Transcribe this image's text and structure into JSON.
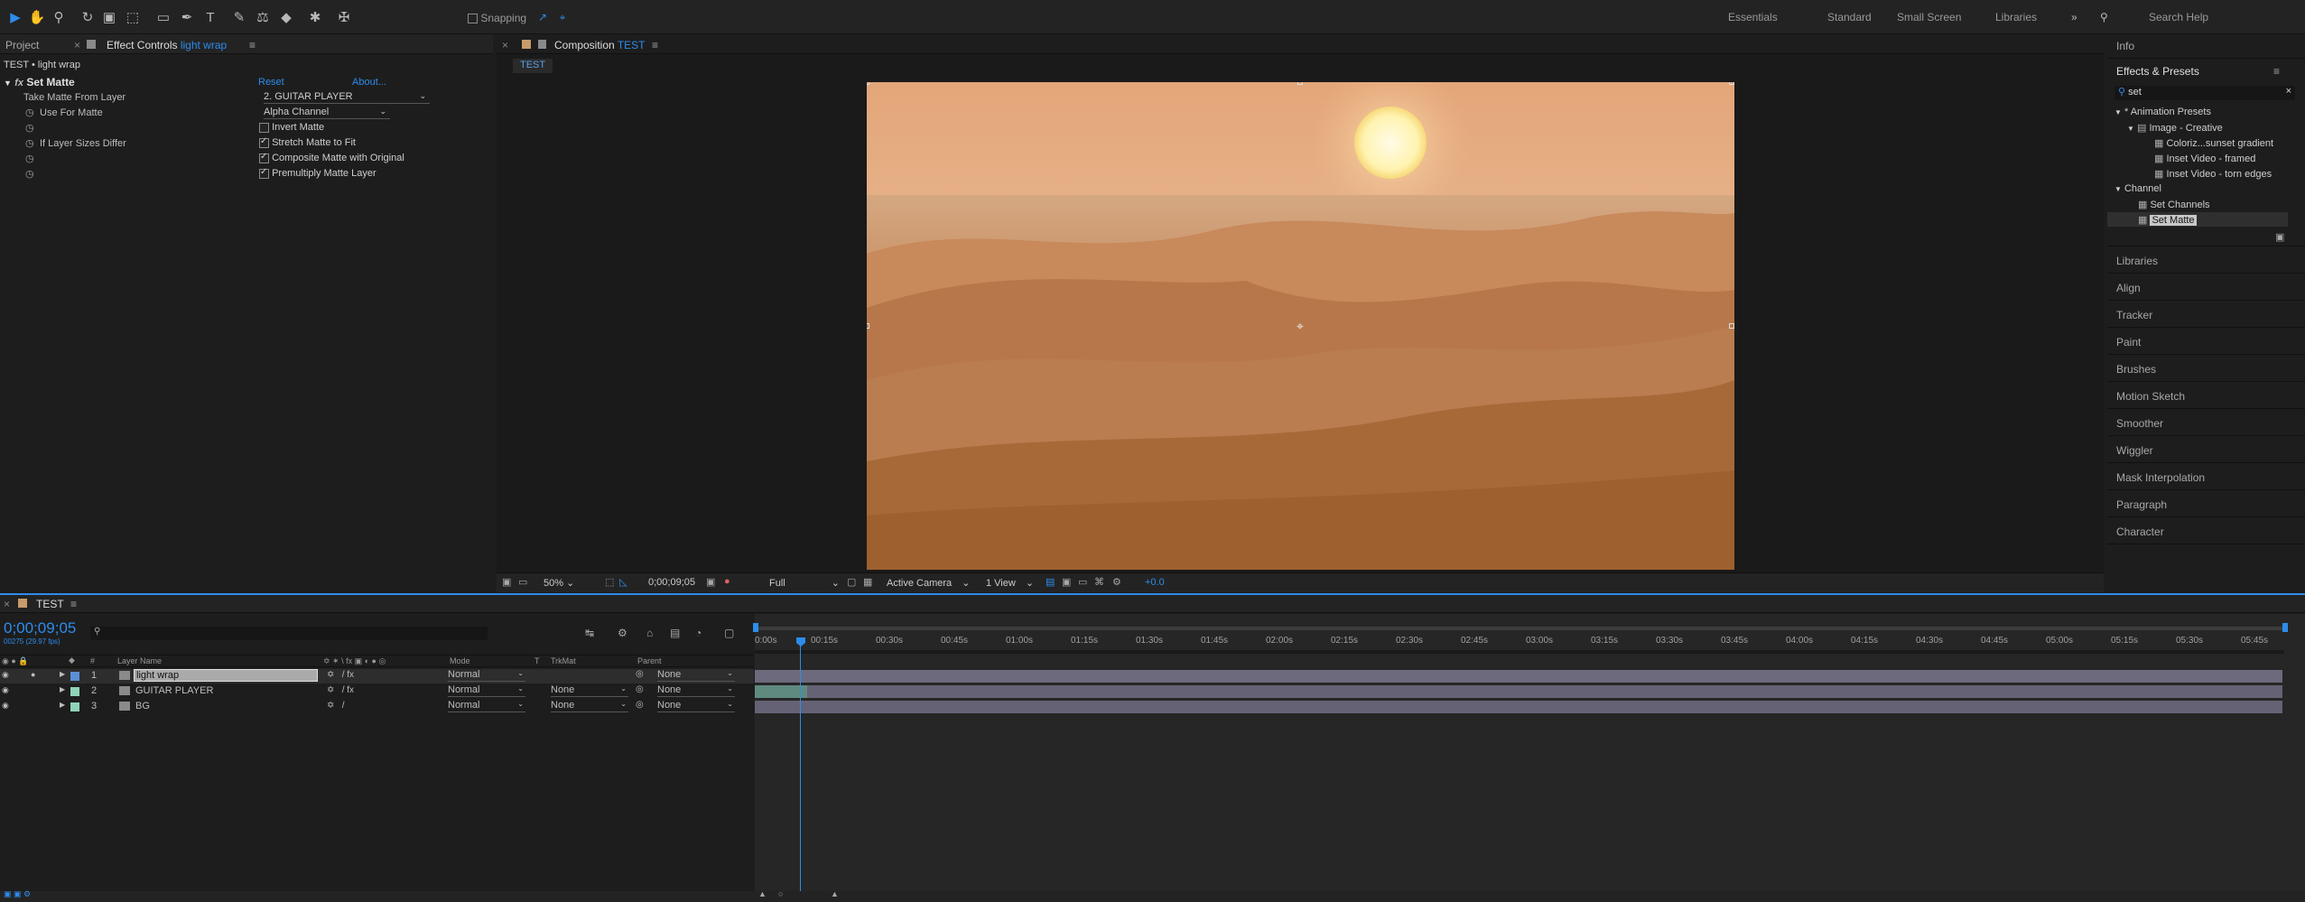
{
  "toolbar": {
    "snapping": "Snapping",
    "workspaces": [
      "Essentials",
      "Standard",
      "Small Screen",
      "Libraries"
    ],
    "search_help": "Search Help"
  },
  "left": {
    "tab_project": "Project",
    "tab_effect_controls": "Effect Controls",
    "ec_layer": "light wrap",
    "breadcrumb": "TEST • light wrap",
    "effect_name": "Set Matte",
    "reset": "Reset",
    "about": "About...",
    "props": [
      {
        "label": "Take Matte From Layer",
        "value": "2. GUITAR PLAYER"
      },
      {
        "label": "Use For Matte",
        "value": "Alpha Channel"
      },
      {
        "label": "",
        "value": "Invert Matte",
        "checked": false
      },
      {
        "label": "If Layer Sizes Differ",
        "value": "Stretch Matte to Fit",
        "checked": true
      },
      {
        "label": "",
        "value": "Composite Matte with Original",
        "checked": true
      },
      {
        "label": "",
        "value": "Premultiply Matte Layer",
        "checked": true
      }
    ]
  },
  "comp": {
    "tab_label": "Composition",
    "comp_name": "TEST",
    "sub_tab": "TEST",
    "zoom": "50%",
    "timecode": "0;00;09;05",
    "resolution": "Full",
    "camera": "Active Camera",
    "view": "1 View",
    "exposure": "+0.0"
  },
  "right": {
    "info": "Info",
    "effects_presets": "Effects & Presets",
    "search_value": "set",
    "tree": [
      {
        "label": "* Animation Presets",
        "level": 0
      },
      {
        "label": "Image - Creative",
        "level": 1
      },
      {
        "label": "Coloriz...sunset gradient",
        "level": 2
      },
      {
        "label": "Inset Video - framed",
        "level": 2
      },
      {
        "label": "Inset Video - torn edges",
        "level": 2
      },
      {
        "label": "Channel",
        "level": 0
      },
      {
        "label": "Set Channels",
        "level": 1
      },
      {
        "label": "Set Matte",
        "level": 1
      }
    ],
    "panels": [
      "Libraries",
      "Align",
      "Tracker",
      "Paint",
      "Brushes",
      "Motion Sketch",
      "Smoother",
      "Wiggler",
      "Mask Interpolation",
      "Paragraph",
      "Character"
    ]
  },
  "timeline": {
    "tab": "TEST",
    "timecode": "0;00;09;05",
    "fps": "00275 (29.97 fps)",
    "col_layer_name": "Layer Name",
    "col_mode": "Mode",
    "col_t": "T",
    "col_trkmat": "TrkMat",
    "col_parent": "Parent",
    "col_num": "#",
    "layers": [
      {
        "num": "1",
        "name": "light wrap",
        "mode": "Normal",
        "trkmat": "",
        "parent": "None"
      },
      {
        "num": "2",
        "name": "GUITAR PLAYER",
        "mode": "Normal",
        "trkmat": "None",
        "parent": "None"
      },
      {
        "num": "3",
        "name": "BG",
        "mode": "Normal",
        "trkmat": "None",
        "parent": "None"
      }
    ],
    "ticks": [
      "0:00s",
      "00:15s",
      "00:30s",
      "00:45s",
      "01:00s",
      "01:15s",
      "01:30s",
      "01:45s",
      "02:00s",
      "02:15s",
      "02:30s",
      "02:45s",
      "03:00s",
      "03:15s",
      "03:30s",
      "03:45s",
      "04:00s",
      "04:15s",
      "04:30s",
      "04:45s",
      "05:00s",
      "05:15s",
      "05:30s",
      "05:45s"
    ]
  },
  "colors": {
    "accent": "#2d8ceb",
    "label_blue": "#5c8fd6",
    "label_green": "#8fd3b9"
  }
}
